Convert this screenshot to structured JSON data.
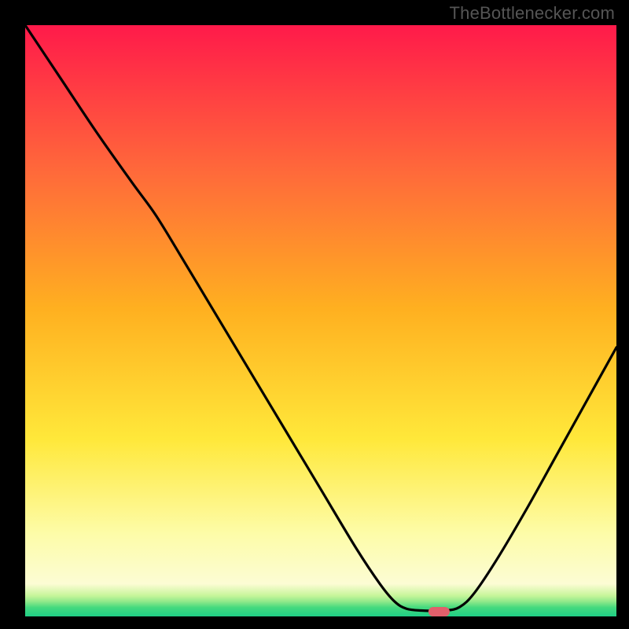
{
  "watermark": "TheBottlenecker.com",
  "chart_data": {
    "type": "line",
    "title": "",
    "xlabel": "",
    "ylabel": "",
    "xlim": [
      0,
      100
    ],
    "ylim": [
      0,
      100
    ],
    "background": {
      "type": "vertical-gradient",
      "stops": [
        {
          "pos": 0.0,
          "color": "#ff1a4a"
        },
        {
          "pos": 0.25,
          "color": "#ff6a3a"
        },
        {
          "pos": 0.48,
          "color": "#ffb020"
        },
        {
          "pos": 0.7,
          "color": "#ffe83a"
        },
        {
          "pos": 0.86,
          "color": "#fdfca8"
        },
        {
          "pos": 0.945,
          "color": "#fcfcd4"
        },
        {
          "pos": 0.965,
          "color": "#c6f59a"
        },
        {
          "pos": 0.975,
          "color": "#8fe98a"
        },
        {
          "pos": 0.985,
          "color": "#44d97e"
        },
        {
          "pos": 1.0,
          "color": "#1fcf86"
        }
      ]
    },
    "series": [
      {
        "name": "curve",
        "points": [
          {
            "x": 0.0,
            "y": 100.0
          },
          {
            "x": 6.0,
            "y": 91.0
          },
          {
            "x": 12.0,
            "y": 82.0
          },
          {
            "x": 18.0,
            "y": 73.5
          },
          {
            "x": 22.0,
            "y": 68.0
          },
          {
            "x": 26.0,
            "y": 61.5
          },
          {
            "x": 32.0,
            "y": 51.5
          },
          {
            "x": 38.0,
            "y": 41.5
          },
          {
            "x": 44.0,
            "y": 31.5
          },
          {
            "x": 50.0,
            "y": 21.5
          },
          {
            "x": 56.0,
            "y": 11.5
          },
          {
            "x": 60.0,
            "y": 5.5
          },
          {
            "x": 62.5,
            "y": 2.5
          },
          {
            "x": 64.5,
            "y": 1.3
          },
          {
            "x": 67.0,
            "y": 1.0
          },
          {
            "x": 71.0,
            "y": 1.0
          },
          {
            "x": 73.5,
            "y": 1.6
          },
          {
            "x": 76.0,
            "y": 4.0
          },
          {
            "x": 80.0,
            "y": 10.0
          },
          {
            "x": 85.0,
            "y": 18.5
          },
          {
            "x": 90.0,
            "y": 27.5
          },
          {
            "x": 95.0,
            "y": 36.5
          },
          {
            "x": 100.0,
            "y": 45.5
          }
        ]
      }
    ],
    "marker": {
      "shape": "rounded-rect",
      "x": 70.0,
      "y": 0.8,
      "width": 3.6,
      "height": 1.6,
      "color": "#e25f6b"
    }
  }
}
